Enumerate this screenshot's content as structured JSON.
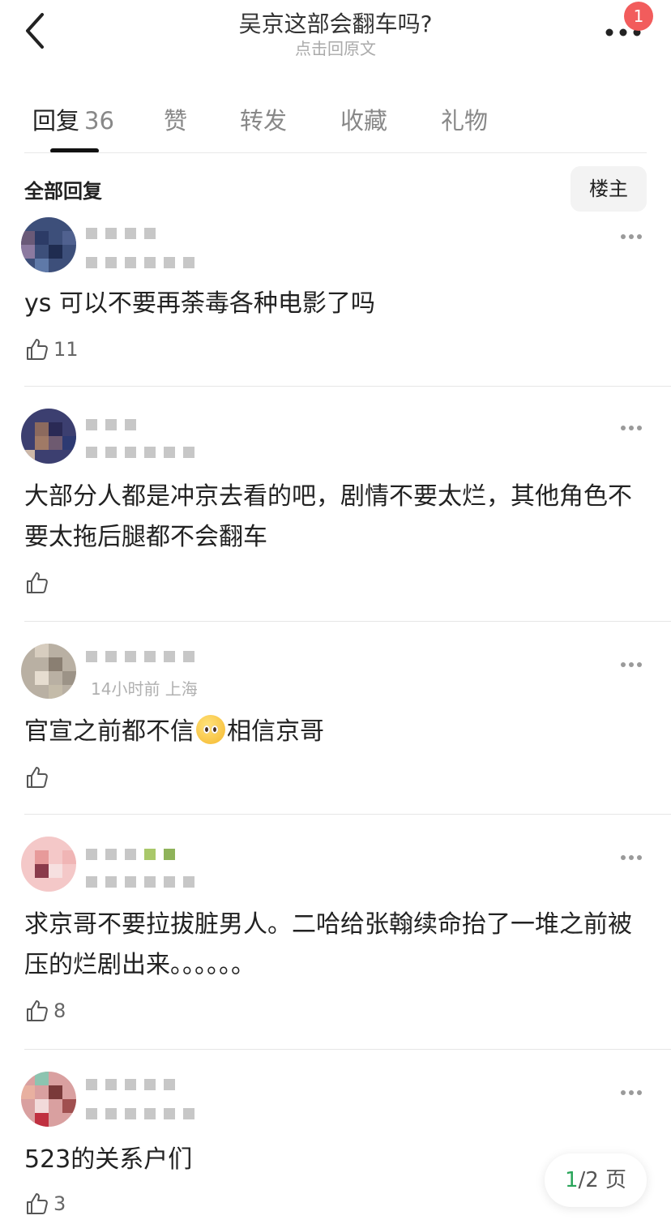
{
  "header": {
    "title": "吴京这部会翻车吗?",
    "subtitle": "点击回原文",
    "notification_count": "1"
  },
  "tabs": [
    {
      "label": "回复",
      "count": "36",
      "active": true
    },
    {
      "label": "赞"
    },
    {
      "label": "转发"
    },
    {
      "label": "收藏"
    },
    {
      "label": "礼物"
    }
  ],
  "filter": {
    "all_replies_label": "全部回复",
    "op_only_label": "楼主"
  },
  "comments": [
    {
      "text": "ys 可以不要再荼毒各种电影了吗",
      "likes": "11",
      "meta": "",
      "avatar_color": "#3d4f7a"
    },
    {
      "text": "大部分人都是冲京去看的吧，剧情不要太烂，其他角色不要太拖后腿都不会翻车",
      "likes": "",
      "meta": "",
      "avatar_color": "#3c3f70"
    },
    {
      "text_before": "官宣之前都不信",
      "text_after": "相信京哥",
      "emoji": "pleading-face",
      "likes": "",
      "meta": "14小时前 上海",
      "avatar_color": "#b9b0a3"
    },
    {
      "text": "求京哥不要拉拔脏男人。二哈给张翰续命抬了一堆之前被压的烂剧出来。。。。。。",
      "likes": "8",
      "meta": "",
      "avatar_color": "#f4c8c8"
    },
    {
      "text": "523的关系户们",
      "likes": "3",
      "meta": "",
      "avatar_color": "#d9a0a0"
    }
  ],
  "pager": {
    "current": "1",
    "total": "/2 页"
  },
  "colors": {
    "accent_green": "#2aa55a",
    "badge_red": "#f25c5c"
  }
}
